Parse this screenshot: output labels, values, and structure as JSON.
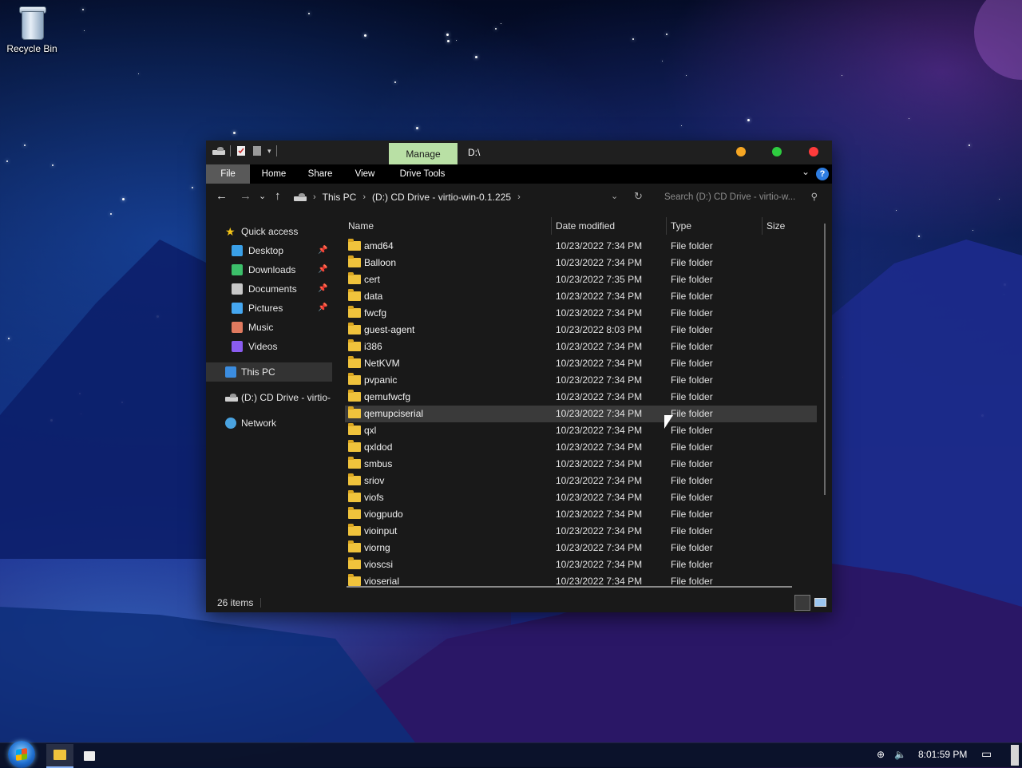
{
  "desktop": {
    "recycle_bin_label": "Recycle Bin"
  },
  "window": {
    "manage_tab": "Manage",
    "title": "D:\\",
    "window_controls": {
      "minimize_color": "#f5a623",
      "maximize_color": "#2ecc40",
      "close_color": "#ff3b3b"
    }
  },
  "ribbon": {
    "tabs": [
      "File",
      "Home",
      "Share",
      "View",
      "Drive Tools"
    ],
    "help_label": "?"
  },
  "address": {
    "crumbs": [
      "This PC",
      "(D:) CD Drive - virtio-win-0.1.225"
    ],
    "search_placeholder": "Search (D:) CD Drive - virtio-w..."
  },
  "nav": {
    "quick_access": "Quick access",
    "items": [
      {
        "label": "Desktop",
        "icon": "desktop-icon",
        "pinned": true
      },
      {
        "label": "Downloads",
        "icon": "downloads-icon",
        "pinned": true
      },
      {
        "label": "Documents",
        "icon": "documents-icon",
        "pinned": true
      },
      {
        "label": "Pictures",
        "icon": "pictures-icon",
        "pinned": true
      },
      {
        "label": "Music",
        "icon": "music-icon",
        "pinned": false
      },
      {
        "label": "Videos",
        "icon": "videos-icon",
        "pinned": false
      }
    ],
    "this_pc": "This PC",
    "cd_drive": "(D:) CD Drive - virtio-",
    "network": "Network"
  },
  "columns": {
    "name": "Name",
    "date": "Date modified",
    "type": "Type",
    "size": "Size"
  },
  "files": [
    {
      "name": "amd64",
      "date": "10/23/2022 7:34 PM",
      "type": "File folder"
    },
    {
      "name": "Balloon",
      "date": "10/23/2022 7:34 PM",
      "type": "File folder"
    },
    {
      "name": "cert",
      "date": "10/23/2022 7:35 PM",
      "type": "File folder"
    },
    {
      "name": "data",
      "date": "10/23/2022 7:34 PM",
      "type": "File folder"
    },
    {
      "name": "fwcfg",
      "date": "10/23/2022 7:34 PM",
      "type": "File folder"
    },
    {
      "name": "guest-agent",
      "date": "10/23/2022 8:03 PM",
      "type": "File folder"
    },
    {
      "name": "i386",
      "date": "10/23/2022 7:34 PM",
      "type": "File folder"
    },
    {
      "name": "NetKVM",
      "date": "10/23/2022 7:34 PM",
      "type": "File folder"
    },
    {
      "name": "pvpanic",
      "date": "10/23/2022 7:34 PM",
      "type": "File folder"
    },
    {
      "name": "qemufwcfg",
      "date": "10/23/2022 7:34 PM",
      "type": "File folder"
    },
    {
      "name": "qemupciserial",
      "date": "10/23/2022 7:34 PM",
      "type": "File folder",
      "selected": true
    },
    {
      "name": "qxl",
      "date": "10/23/2022 7:34 PM",
      "type": "File folder"
    },
    {
      "name": "qxldod",
      "date": "10/23/2022 7:34 PM",
      "type": "File folder"
    },
    {
      "name": "smbus",
      "date": "10/23/2022 7:34 PM",
      "type": "File folder"
    },
    {
      "name": "sriov",
      "date": "10/23/2022 7:34 PM",
      "type": "File folder"
    },
    {
      "name": "viofs",
      "date": "10/23/2022 7:34 PM",
      "type": "File folder"
    },
    {
      "name": "viogpudo",
      "date": "10/23/2022 7:34 PM",
      "type": "File folder"
    },
    {
      "name": "vioinput",
      "date": "10/23/2022 7:34 PM",
      "type": "File folder"
    },
    {
      "name": "viorng",
      "date": "10/23/2022 7:34 PM",
      "type": "File folder"
    },
    {
      "name": "vioscsi",
      "date": "10/23/2022 7:34 PM",
      "type": "File folder"
    },
    {
      "name": "vioserial",
      "date": "10/23/2022 7:34 PM",
      "type": "File folder"
    }
  ],
  "status": {
    "item_count": "26 items"
  },
  "taskbar": {
    "clock": "8:01:59 PM"
  }
}
